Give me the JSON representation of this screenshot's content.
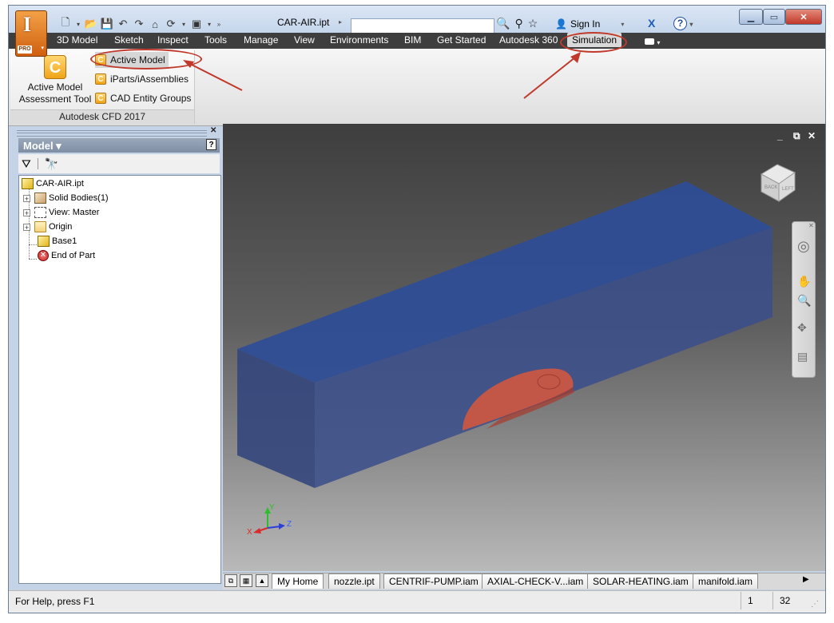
{
  "app": {
    "logo_letter": "I",
    "edition": "PRO",
    "document_title": "CAR-AIR.ipt",
    "sign_in": "Sign In"
  },
  "menu": {
    "items": [
      "3D Model",
      "Sketch",
      "Inspect",
      "Tools",
      "Manage",
      "View",
      "Environments",
      "BIM",
      "Get Started",
      "Autodesk 360",
      "Simulation"
    ]
  },
  "ribbon": {
    "big_button": "Active Model Assessment Tool",
    "small_buttons": [
      "Active Model",
      "iParts/iAssemblies",
      "CAD Entity Groups"
    ],
    "panel_title": "Autodesk CFD 2017"
  },
  "browser": {
    "title": "Model ▾",
    "help": "?",
    "tree": [
      {
        "label": "CAR-AIR.ipt",
        "icon": "part-icon"
      },
      {
        "label": "Solid Bodies(1)",
        "icon": "solid-bodies-icon"
      },
      {
        "label": "View: Master",
        "icon": "view-rep-icon"
      },
      {
        "label": "Origin",
        "icon": "folder-icon"
      },
      {
        "label": "Base1",
        "icon": "extrusion-icon"
      },
      {
        "label": "End of Part",
        "icon": "end-of-part-icon"
      }
    ]
  },
  "viewcube": {
    "face_left": "LEFT",
    "face_back": "BACK"
  },
  "triad": {
    "x": "X",
    "y": "Y",
    "z": "Z"
  },
  "doc_tabs": [
    "My Home",
    "nozzle.ipt",
    "CENTRIF-PUMP.iam",
    "AXIAL-CHECK-V...iam",
    "SOLAR-HEATING.iam",
    "manifold.iam"
  ],
  "status": {
    "help_text": "For Help, press F1",
    "count1": "1",
    "count2": "32"
  },
  "colors": {
    "accent": "#c0392b",
    "menu_bg": "#3e3e3e",
    "box_fill": "#3a4e8a",
    "car_fill": "#d9583c"
  }
}
